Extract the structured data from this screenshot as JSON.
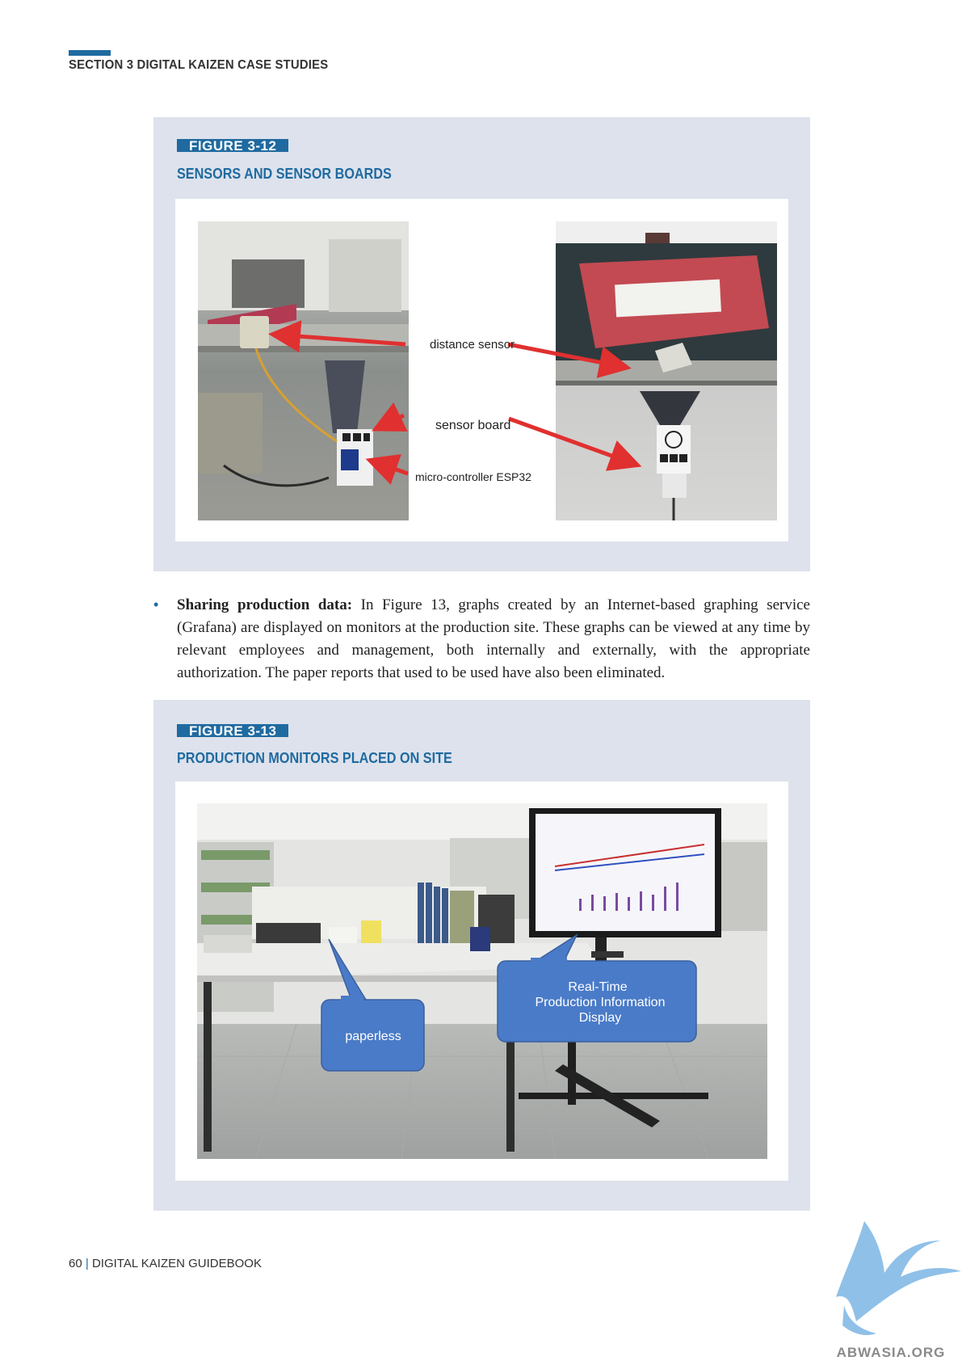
{
  "header": {
    "section_title": "SECTION 3  DIGITAL KAIZEN CASE STUDIES"
  },
  "figure_12": {
    "label": "FIGURE 3-12",
    "title": "SENSORS AND SENSOR BOARDS",
    "annotations": {
      "distance_sensor": "distance sensor",
      "sensor_board": "sensor board",
      "microcontroller": "micro-controller ESP32"
    }
  },
  "body": {
    "bold_lead": "Sharing production data:",
    "text": " In Figure 13, graphs created by an Internet-based graphing service (Grafana) are displayed on monitors at the production site. These graphs can be viewed at any time by relevant employees and management, both internally and externally, with the appropriate authorization. The paper reports that used to be used have also been eliminated."
  },
  "figure_13": {
    "label": "FIGURE 3-13",
    "title": "PRODUCTION MONITORS PLACED ON SITE",
    "callouts": {
      "paperless": "paperless",
      "realtime_line1": "Real-Time",
      "realtime_line2": "Production Information",
      "realtime_line3": "Display"
    }
  },
  "footer": {
    "page_number": "60",
    "separator": "|",
    "book_title": "DIGITAL KAIZEN GUIDEBOOK"
  },
  "watermark": {
    "text": "ABWASIA.ORG"
  },
  "colors": {
    "accent_blue": "#1f6aa0",
    "figure_bg": "#dde2ec",
    "callout_blue": "#4a7bc8",
    "arrow_red": "#e03030"
  }
}
